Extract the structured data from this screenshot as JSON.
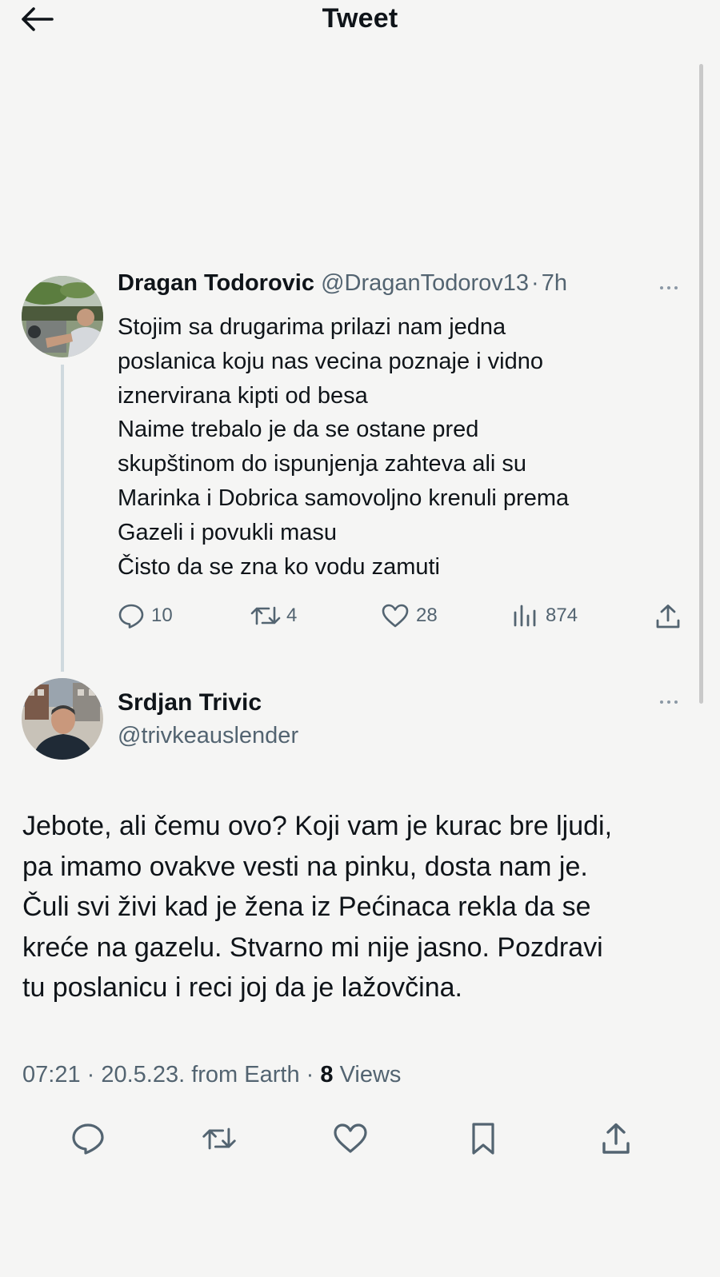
{
  "header": {
    "title": "Tweet"
  },
  "reply": {
    "author_name": "Dragan Todorovic",
    "handle": "@DraganTodorov13",
    "separator": "·",
    "time": "7h",
    "lines": [
      "Stojim sa drugarima prilazi nam jedna",
      "poslanica koju nas vecina poznaje i vidno",
      "iznervirana kipti od besa",
      "Naime trebalo je da se ostane pred",
      "skupštinom do ispunjenja zahteva ali su",
      "Marinka i Dobrica samovoljno krenuli prema",
      "Gazeli i povukli masu",
      "Čisto da se zna ko vodu zamuti"
    ],
    "stats": {
      "replies": "10",
      "retweets": "4",
      "likes": "28",
      "views": "874"
    }
  },
  "main_tweet": {
    "author_name": "Srdjan Trivic",
    "handle": "@trivkeauslender",
    "lines": [
      "Jebote, ali čemu ovo? Koji vam je kurac bre ljudi,",
      "pa imamo ovakve vesti na pinku, dosta nam je.",
      "Čuli svi živi kad je žena iz Pećinaca rekla da se",
      "kreće na gazelu. Stvarno mi nije jasno. Pozdravi",
      "tu poslanicu i reci joj da je lažovčina."
    ],
    "info": {
      "timestamp": "07:21 · 20.5.23. from Earth ·",
      "views_count": "8",
      "views_label": "Views"
    }
  },
  "icons": {
    "back": "arrow-left-icon",
    "more": "more-dots-icon",
    "reply": "comment-icon",
    "retweet": "retweet-icon",
    "like": "heart-icon",
    "views": "bar-chart-icon",
    "share": "share-icon",
    "bookmark": "bookmark-icon"
  },
  "colors": {
    "background": "#f5f5f4",
    "text": "#0f1419",
    "secondary": "#536471",
    "thread_line": "#cfd9de"
  }
}
